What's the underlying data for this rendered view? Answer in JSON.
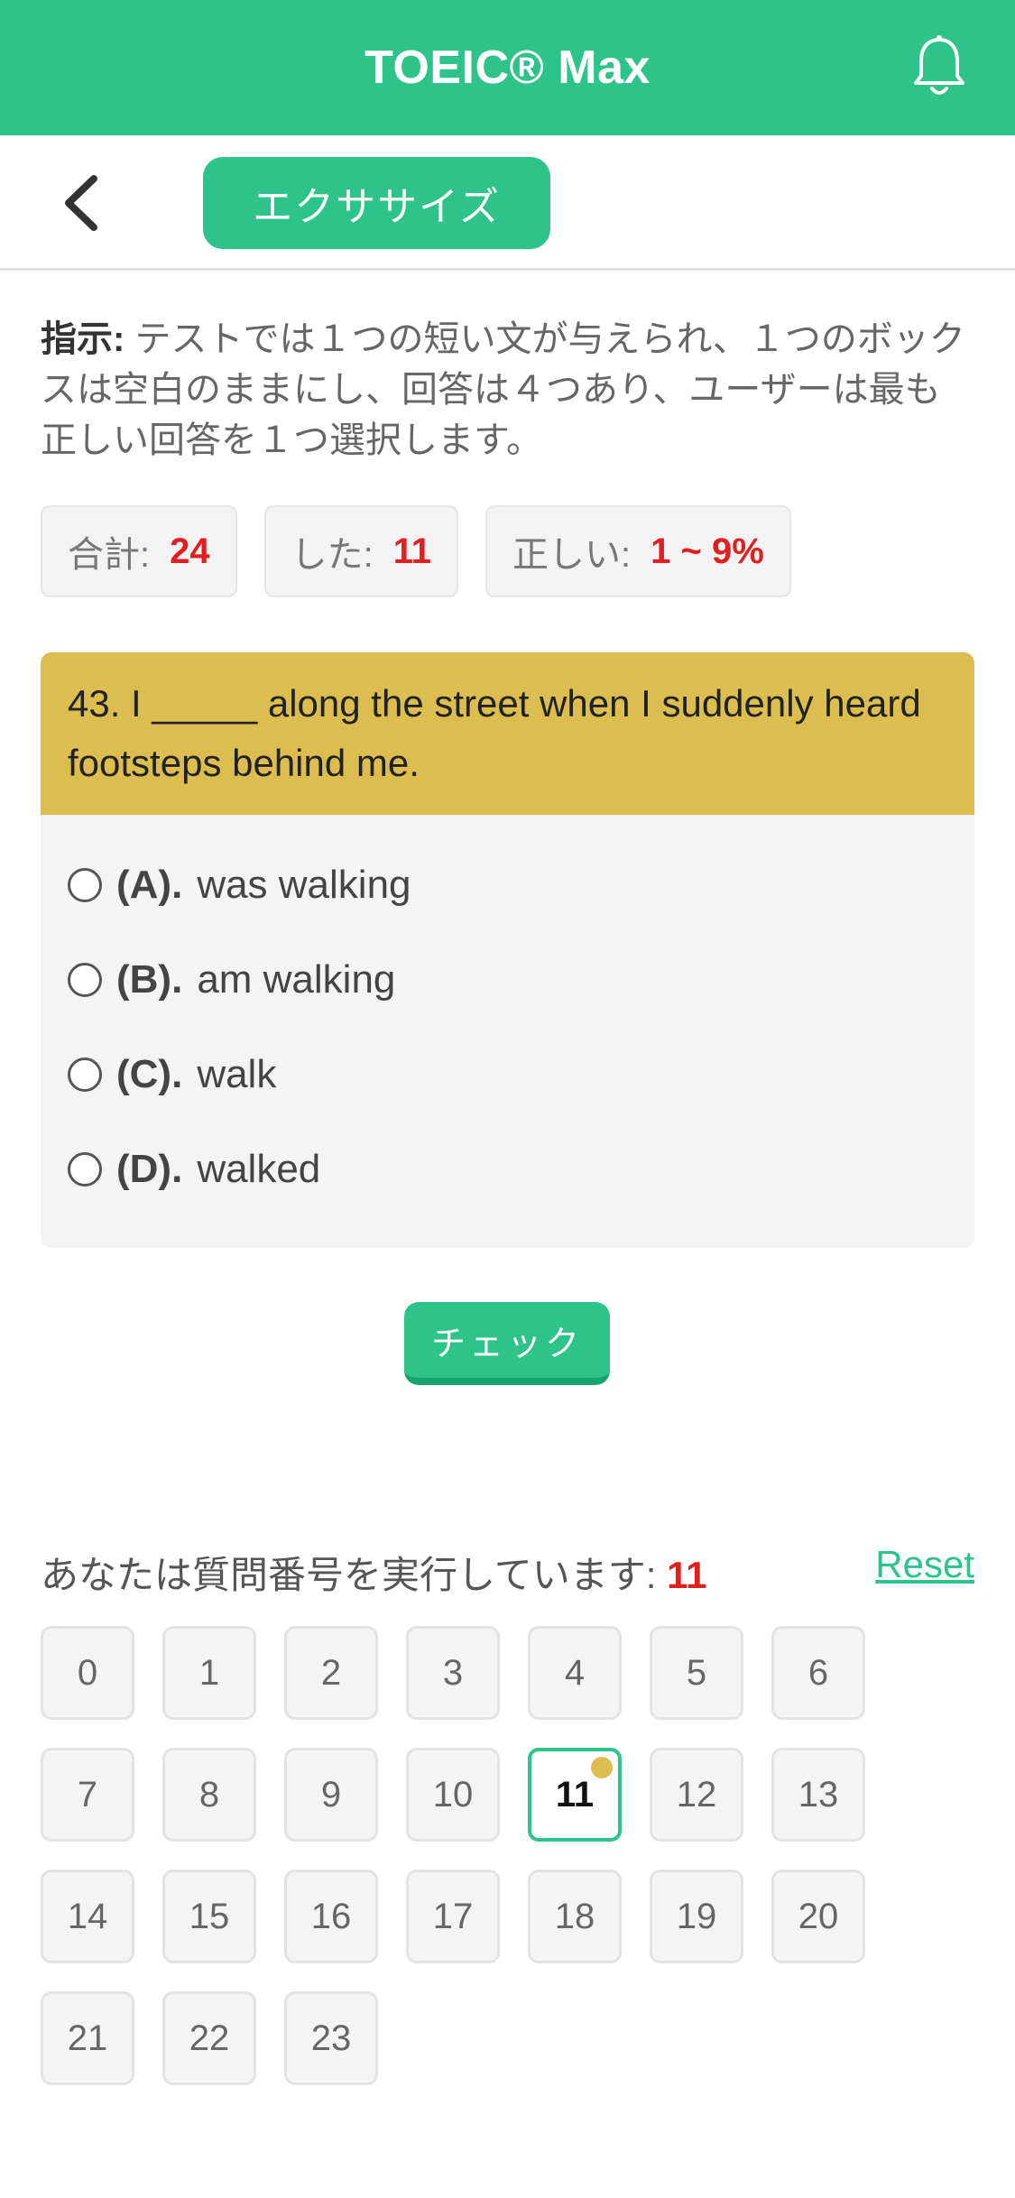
{
  "header": {
    "title": "TOEIC® Max",
    "notification_icon": "bell-icon"
  },
  "subheader": {
    "back_icon": "chevron-left-icon",
    "exercise_label": "エクササイズ"
  },
  "instruction": {
    "lead": "指示:",
    "text": " テストでは１つの短い文が与えられ、１つのボックスは空白のままにし、回答は４つあり、ユーザーは最も正しい回答を１つ選択します。"
  },
  "stats": [
    {
      "label": "合計:",
      "value": "24"
    },
    {
      "label": "した:",
      "value": "11"
    },
    {
      "label": "正しい:",
      "value": "1 ~ 9%"
    }
  ],
  "question": {
    "text": "43. I _____ along the street when I suddenly heard footsteps behind me.",
    "options": [
      {
        "letter": "(A).",
        "text": "was walking"
      },
      {
        "letter": "(B).",
        "text": "am walking"
      },
      {
        "letter": "(C).",
        "text": "walk"
      },
      {
        "letter": "(D).",
        "text": "walked"
      }
    ]
  },
  "check_label": "チェック",
  "progress": {
    "label": "あなたは質問番号を実行しています:",
    "current": "11",
    "reset_label": "Reset"
  },
  "question_numbers": [
    "0",
    "1",
    "2",
    "3",
    "4",
    "5",
    "6",
    "7",
    "8",
    "9",
    "10",
    "11",
    "12",
    "13",
    "14",
    "15",
    "16",
    "17",
    "18",
    "19",
    "20",
    "21",
    "22",
    "23"
  ],
  "colors": {
    "accent": "#2ec38a",
    "question_bg": "#dcbd50",
    "highlight": "#e02020"
  }
}
